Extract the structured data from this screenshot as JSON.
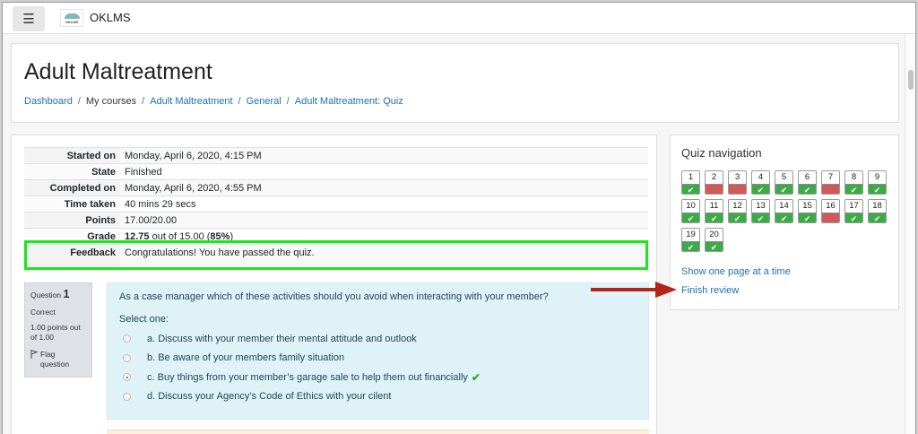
{
  "site": {
    "name": "OKLMS",
    "logo_text": "OKLMS"
  },
  "page": {
    "title": "Adult Maltreatment"
  },
  "breadcrumb": [
    {
      "label": "Dashboard",
      "link": true
    },
    {
      "label": "My courses",
      "link": false
    },
    {
      "label": "Adult Maltreatment",
      "link": true
    },
    {
      "label": "General",
      "link": true
    },
    {
      "label": "Adult Maltreatment: Quiz",
      "link": true
    }
  ],
  "summary": {
    "started_on": {
      "label": "Started on",
      "value": "Monday, April 6, 2020, 4:15 PM"
    },
    "state": {
      "label": "State",
      "value": "Finished"
    },
    "completed_on": {
      "label": "Completed on",
      "value": "Monday, April 6, 2020, 4:55 PM"
    },
    "time_taken": {
      "label": "Time taken",
      "value": "40 mins 29 secs"
    },
    "points": {
      "label": "Points",
      "value": "17.00/20.00"
    },
    "grade": {
      "label": "Grade",
      "score": "12.75",
      "mid": " out of 15.00 (",
      "percent": "85%",
      "end": ")"
    },
    "feedback": {
      "label": "Feedback",
      "value": "Congratulations! You have passed the quiz."
    }
  },
  "question": {
    "prefix": "Question",
    "number": "1",
    "status": "Correct",
    "points": "1.00 points out of 1.00",
    "flag_label": "Flag question",
    "text": "As a case manager which of these activities should you avoid when interacting with your member?",
    "prompt": "Select one:",
    "answers": [
      {
        "text": "a. Discuss with your member their mental attitude and outlook",
        "selected": false
      },
      {
        "text": "b. Be aware of your members family situation",
        "selected": false
      },
      {
        "text": "c. Buy things from your member’s garage sale to help them out financially",
        "selected": true,
        "correct": true
      },
      {
        "text": "d. Discuss your Agency’s Code of Ethics with your cilent",
        "selected": false
      }
    ]
  },
  "quiz_nav": {
    "title": "Quiz navigation",
    "questions": [
      {
        "n": "1",
        "status": "correct"
      },
      {
        "n": "2",
        "status": "incorrect"
      },
      {
        "n": "3",
        "status": "incorrect"
      },
      {
        "n": "4",
        "status": "correct"
      },
      {
        "n": "5",
        "status": "correct"
      },
      {
        "n": "6",
        "status": "correct"
      },
      {
        "n": "7",
        "status": "incorrect"
      },
      {
        "n": "8",
        "status": "correct"
      },
      {
        "n": "9",
        "status": "correct"
      },
      {
        "n": "10",
        "status": "correct"
      },
      {
        "n": "11",
        "status": "correct"
      },
      {
        "n": "12",
        "status": "correct"
      },
      {
        "n": "13",
        "status": "correct"
      },
      {
        "n": "14",
        "status": "correct"
      },
      {
        "n": "15",
        "status": "correct"
      },
      {
        "n": "16",
        "status": "incorrect"
      },
      {
        "n": "17",
        "status": "correct"
      },
      {
        "n": "18",
        "status": "correct"
      },
      {
        "n": "19",
        "status": "correct"
      },
      {
        "n": "20",
        "status": "correct"
      }
    ],
    "show_one_page": "Show one page at a time",
    "finish_review": "Finish review"
  },
  "colors": {
    "correct": "#3cab47",
    "incorrect": "#d05a5a",
    "highlight": "#19e91b",
    "arrow": "#b3241a",
    "link": "#1f6fb2"
  },
  "icons": {
    "menu": "hamburger-icon",
    "flag": "flag-icon",
    "check": "check-icon",
    "arrow": "arrow-right-icon"
  }
}
